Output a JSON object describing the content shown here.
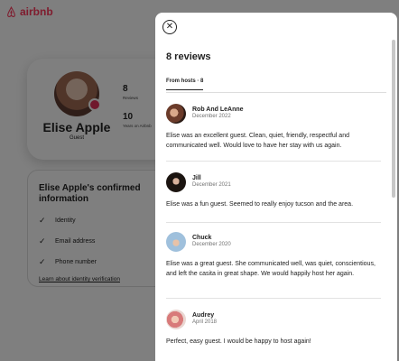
{
  "brand": {
    "name": "airbnb",
    "color": "#ff385c"
  },
  "profile": {
    "name": "Elise Apple",
    "role": "Guest",
    "stats": [
      {
        "value": "8",
        "label": "Reviews"
      },
      {
        "value": "10",
        "label": "Years on Airbnb"
      }
    ]
  },
  "confirmed": {
    "title": "Elise Apple's confirmed information",
    "items": [
      "Identity",
      "Email address",
      "Phone number"
    ],
    "link": "Learn about identity verification"
  },
  "modal": {
    "close_icon": "close-icon",
    "title": "8 reviews",
    "tab": "From hosts · 8",
    "reviews": [
      {
        "name": "Rob And LeAnne",
        "date": "December 2022",
        "text": "Elise was an excellent guest. Clean, quiet, friendly, respectful and communicated well. Would love to have her stay with us again."
      },
      {
        "name": "Jill",
        "date": "December 2021",
        "text": "Elise was a fun guest. Seemed to really enjoy tucson and the area."
      },
      {
        "name": "Chuck",
        "date": "December 2020",
        "text": "Elise was a great guest. She communicated well, was quiet, conscientious, and left the casita in great shape. We would happily host her again."
      },
      {
        "name": "Audrey",
        "date": "April 2018",
        "text": "Perfect, easy guest. I would be happy to host again!"
      }
    ]
  }
}
